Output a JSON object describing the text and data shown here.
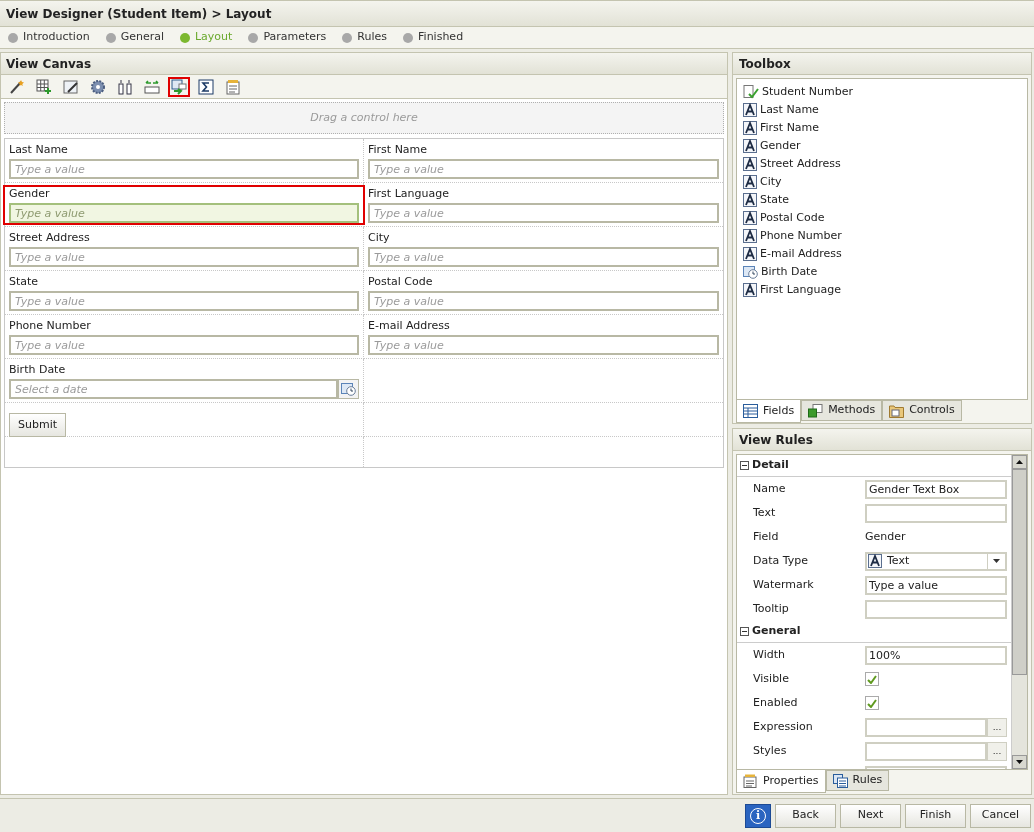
{
  "window": {
    "title": "View Designer (Student Item) > Layout"
  },
  "steps": [
    {
      "label": "Introduction",
      "selected": false
    },
    {
      "label": "General",
      "selected": false
    },
    {
      "label": "Layout",
      "selected": true
    },
    {
      "label": "Parameters",
      "selected": false
    },
    {
      "label": "Rules",
      "selected": false
    },
    {
      "label": "Finished",
      "selected": false
    }
  ],
  "canvas": {
    "title": "View Canvas",
    "toolbar": [
      {
        "kind": "wand",
        "selected": false
      },
      {
        "kind": "table-add",
        "selected": false
      },
      {
        "kind": "edit",
        "selected": false
      },
      {
        "kind": "gear",
        "selected": false
      },
      {
        "kind": "columns",
        "selected": false
      },
      {
        "kind": "swap",
        "selected": false
      },
      {
        "kind": "form-arrow",
        "selected": true
      },
      {
        "kind": "sigma",
        "selected": false
      },
      {
        "kind": "notes",
        "selected": false
      }
    ],
    "drop_hint": "Drag a control here",
    "rows": [
      {
        "cells": [
          {
            "kind": "text",
            "label": "Last Name",
            "placeholder": "Type a value",
            "selected": false
          },
          {
            "kind": "text",
            "label": "First Name",
            "placeholder": "Type a value",
            "selected": false
          }
        ]
      },
      {
        "cells": [
          {
            "kind": "text",
            "label": "Gender",
            "placeholder": "Type a value",
            "selected": true
          },
          {
            "kind": "text",
            "label": "First Language",
            "placeholder": "Type a value",
            "selected": false
          }
        ]
      },
      {
        "cells": [
          {
            "kind": "text",
            "label": "Street Address",
            "placeholder": "Type a value",
            "selected": false
          },
          {
            "kind": "text",
            "label": "City",
            "placeholder": "Type a value",
            "selected": false
          }
        ]
      },
      {
        "cells": [
          {
            "kind": "text",
            "label": "State",
            "placeholder": "Type a value",
            "selected": false
          },
          {
            "kind": "text",
            "label": "Postal Code",
            "placeholder": "Type a value",
            "selected": false
          }
        ]
      },
      {
        "cells": [
          {
            "kind": "text",
            "label": "Phone Number",
            "placeholder": "Type a value",
            "selected": false
          },
          {
            "kind": "text",
            "label": "E-mail Address",
            "placeholder": "Type a value",
            "selected": false
          }
        ]
      },
      {
        "cells": [
          {
            "kind": "date",
            "label": "Birth Date",
            "placeholder": "Select a date",
            "selected": false
          },
          {
            "kind": "empty"
          }
        ]
      },
      {
        "cells": [
          {
            "kind": "button",
            "label": "Submit"
          },
          {
            "kind": "empty"
          }
        ]
      },
      {
        "cells": [
          {
            "kind": "empty"
          },
          {
            "kind": "empty"
          }
        ]
      }
    ]
  },
  "toolbox": {
    "title": "Toolbox",
    "items": [
      {
        "kind": "key",
        "label": "Student Number"
      },
      {
        "kind": "text",
        "label": "Last Name"
      },
      {
        "kind": "text",
        "label": "First Name"
      },
      {
        "kind": "text",
        "label": "Gender"
      },
      {
        "kind": "text",
        "label": "Street Address"
      },
      {
        "kind": "text",
        "label": "City"
      },
      {
        "kind": "text",
        "label": "State"
      },
      {
        "kind": "text",
        "label": "Postal Code"
      },
      {
        "kind": "text",
        "label": "Phone Number"
      },
      {
        "kind": "text",
        "label": "E-mail Address"
      },
      {
        "kind": "date",
        "label": "Birth Date"
      },
      {
        "kind": "text",
        "label": "First Language"
      }
    ],
    "tabs": [
      {
        "kind": "fields",
        "label": "Fields",
        "selected": true
      },
      {
        "kind": "methods",
        "label": "Methods",
        "selected": false
      },
      {
        "kind": "controls",
        "label": "Controls",
        "selected": false
      }
    ]
  },
  "view_rules": {
    "title": "View Rules",
    "sections": [
      {
        "title": "Detail",
        "expanded": true,
        "props": [
          {
            "kind": "input",
            "label": "Name",
            "value": "Gender Text Box"
          },
          {
            "kind": "input",
            "label": "Text"
          },
          {
            "kind": "static",
            "label": "Field",
            "value": "Gender"
          },
          {
            "kind": "select",
            "label": "Data Type",
            "value": "Text"
          },
          {
            "kind": "input",
            "label": "Watermark",
            "value": "Type a value"
          },
          {
            "kind": "input",
            "label": "Tooltip"
          }
        ]
      },
      {
        "title": "General",
        "expanded": true,
        "props": [
          {
            "kind": "input",
            "label": "Width",
            "value": "100%"
          },
          {
            "kind": "check",
            "label": "Visible",
            "checked": true
          },
          {
            "kind": "check",
            "label": "Enabled",
            "checked": true
          },
          {
            "kind": "browse",
            "label": "Expression",
            "button": "..."
          },
          {
            "kind": "browse",
            "label": "Styles",
            "button": "..."
          }
        ]
      }
    ],
    "tabs": [
      {
        "kind": "properties",
        "label": "Properties",
        "selected": true
      },
      {
        "kind": "rules",
        "label": "Rules",
        "selected": false
      }
    ]
  },
  "footer": {
    "buttons": [
      {
        "kind": "info",
        "label": "i"
      },
      {
        "kind": "plain",
        "label": "Back"
      },
      {
        "kind": "plain",
        "label": "Next"
      },
      {
        "kind": "plain",
        "label": "Finish"
      },
      {
        "kind": "plain",
        "label": "Cancel"
      }
    ]
  }
}
